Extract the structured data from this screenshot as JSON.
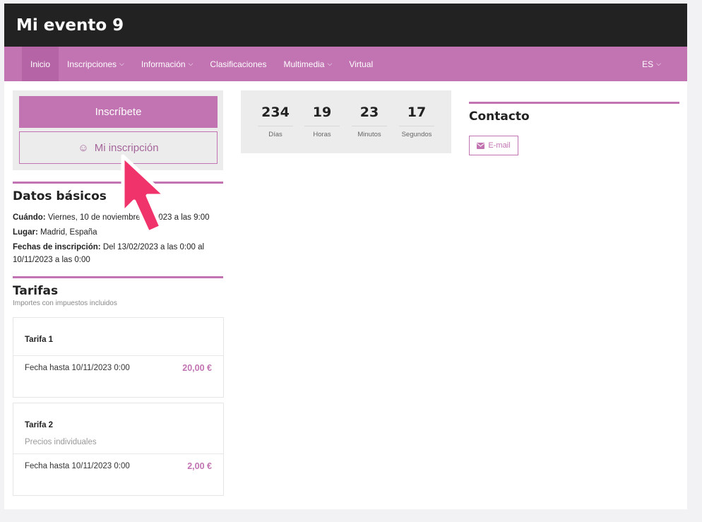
{
  "event": {
    "title": "Mi evento 9"
  },
  "nav": {
    "items": [
      {
        "label": "Inicio"
      },
      {
        "label": "Inscripciones"
      },
      {
        "label": "Información"
      },
      {
        "label": "Clasificaciones"
      },
      {
        "label": "Multimedia"
      },
      {
        "label": "Virtual"
      }
    ],
    "language": "ES"
  },
  "actions": {
    "inscribete_label": "Inscríbete",
    "mi_inscripcion_label": "Mi inscripción"
  },
  "datos": {
    "title": "Datos básicos",
    "cuando_label": "Cuándo:",
    "cuando_value": "Viernes, 10 de noviembre de 2023 a las 9:00",
    "lugar_label": "Lugar:",
    "lugar_value": "Madrid, España",
    "fechas_label": "Fechas de inscripción:",
    "fechas_value": "Del 13/02/2023 a las 0:00 al 10/11/2023 a las 0:00"
  },
  "tarifas": {
    "title": "Tarifas",
    "note": "Importes con impuestos incluidos",
    "items": [
      {
        "name": "Tarifa 1",
        "desc": "",
        "fecha": "Fecha hasta 10/11/2023 0:00",
        "price": "20,00 €"
      },
      {
        "name": "Tarifa 2",
        "desc": "Precios individuales",
        "fecha": "Fecha hasta 10/11/2023 0:00",
        "price": "2,00 €"
      }
    ]
  },
  "countdown": {
    "cells": [
      {
        "value": "234",
        "label": "Días"
      },
      {
        "value": "19",
        "label": "Horas"
      },
      {
        "value": "23",
        "label": "Minutos"
      },
      {
        "value": "17",
        "label": "Segundos"
      }
    ]
  },
  "contact": {
    "title": "Contacto",
    "email_label": "E-mail"
  },
  "colors": {
    "accent": "#c173b2",
    "header": "#222222",
    "cursor": "#f0336b"
  },
  "icons": {
    "smile": "smile-icon",
    "envelope": "envelope-icon",
    "chevron": "chevron-down-icon",
    "pointer": "pointer-arrow-icon"
  }
}
